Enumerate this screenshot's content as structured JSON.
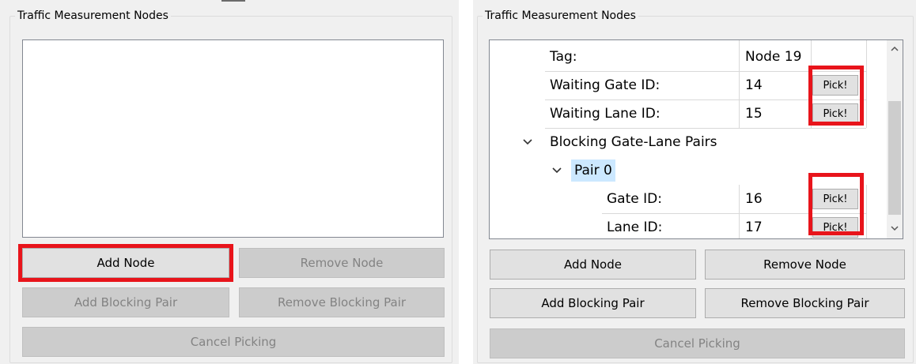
{
  "left": {
    "group_title": "Traffic Measurement Nodes",
    "buttons": {
      "add_node": "Add Node",
      "remove_node": "Remove Node",
      "add_blocking_pair": "Add Blocking Pair",
      "remove_blocking_pair": "Remove Blocking Pair",
      "cancel_picking": "Cancel Picking"
    }
  },
  "right": {
    "group_title": "Traffic Measurement Nodes",
    "tree": {
      "tag_label": "Tag:",
      "tag_value": "Node 19",
      "waiting_gate_label": "Waiting Gate ID:",
      "waiting_gate_value": "14",
      "waiting_lane_label": "Waiting Lane ID:",
      "waiting_lane_value": "15",
      "blocking_pairs_label": "Blocking Gate-Lane Pairs",
      "pair_label": "Pair 0",
      "gate_label": "Gate ID:",
      "gate_value": "16",
      "lane_label": "Lane ID:",
      "lane_value": "17",
      "pick_label": "Pick!"
    },
    "buttons": {
      "add_node": "Add Node",
      "remove_node": "Remove Node",
      "add_blocking_pair": "Add Blocking Pair",
      "remove_blocking_pair": "Remove Blocking Pair",
      "cancel_picking": "Cancel Picking"
    }
  },
  "colors": {
    "highlight": "#e8141b",
    "selected": "#cce8ff",
    "disabled_text": "#838383"
  }
}
